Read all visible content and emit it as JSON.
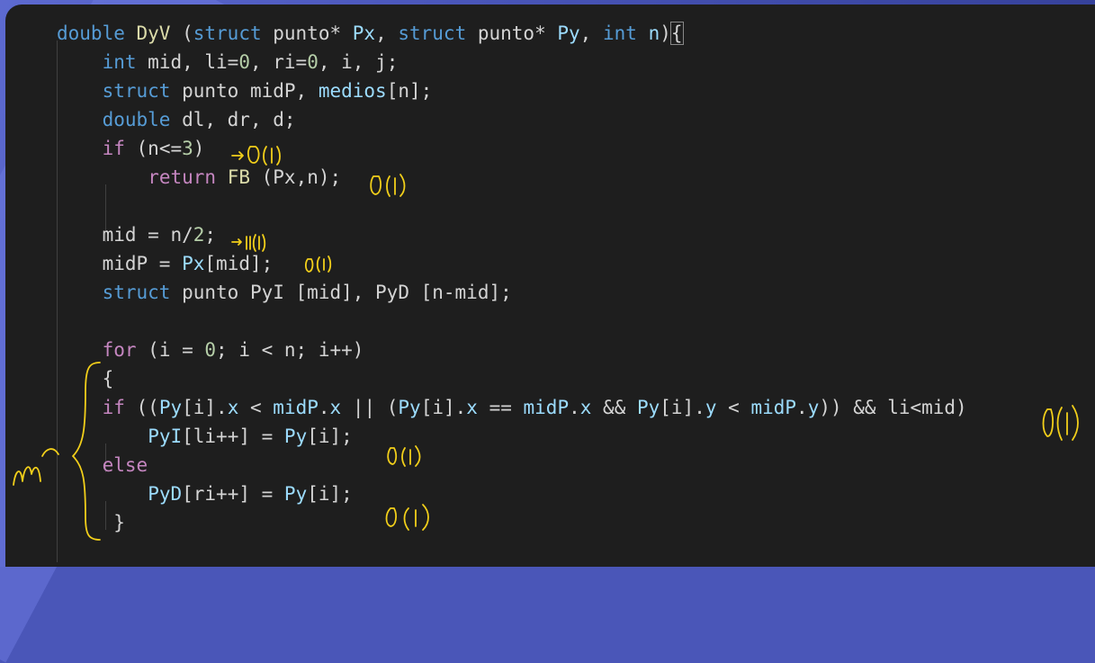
{
  "code": {
    "lines": [
      {
        "indent": "",
        "tokens": [
          [
            "kw",
            "double "
          ],
          [
            "fn",
            "DyV"
          ],
          [
            "t",
            " ("
          ],
          [
            "kw",
            "struct"
          ],
          [
            "t",
            " punto* "
          ],
          [
            "var",
            "Px"
          ],
          [
            "t",
            ", "
          ],
          [
            "kw",
            "struct"
          ],
          [
            "t",
            " punto* "
          ],
          [
            "var",
            "Py"
          ],
          [
            "t",
            ", "
          ],
          [
            "kw",
            "int"
          ],
          [
            "t",
            " "
          ],
          [
            "var",
            "n"
          ],
          [
            "t",
            ")"
          ],
          [
            "hl",
            "{"
          ]
        ]
      },
      {
        "indent": "    ",
        "tokens": [
          [
            "kw",
            "int"
          ],
          [
            "t",
            " mid, li="
          ],
          [
            "num",
            "0"
          ],
          [
            "t",
            ", ri="
          ],
          [
            "num",
            "0"
          ],
          [
            "t",
            ", i, j;"
          ]
        ]
      },
      {
        "indent": "    ",
        "tokens": [
          [
            "kw",
            "struct"
          ],
          [
            "t",
            " punto midP, "
          ],
          [
            "var",
            "medios"
          ],
          [
            "t",
            "[n];"
          ]
        ]
      },
      {
        "indent": "    ",
        "tokens": [
          [
            "kw",
            "double"
          ],
          [
            "t",
            " dl, dr, d;"
          ]
        ]
      },
      {
        "indent": "    ",
        "tokens": [
          [
            "ctl",
            "if"
          ],
          [
            "t",
            " (n<="
          ],
          [
            "num",
            "3"
          ],
          [
            "t",
            ")"
          ]
        ]
      },
      {
        "indent": "        ",
        "tokens": [
          [
            "ctl",
            "return"
          ],
          [
            "t",
            " "
          ],
          [
            "fn",
            "FB"
          ],
          [
            "t",
            " (Px,n);"
          ]
        ]
      },
      {
        "indent": "",
        "tokens": []
      },
      {
        "indent": "    ",
        "tokens": [
          [
            "t",
            "mid = n/"
          ],
          [
            "num",
            "2"
          ],
          [
            "t",
            ";"
          ]
        ]
      },
      {
        "indent": "    ",
        "tokens": [
          [
            "t",
            "midP = "
          ],
          [
            "var",
            "Px"
          ],
          [
            "t",
            "[mid];"
          ]
        ]
      },
      {
        "indent": "    ",
        "tokens": [
          [
            "kw",
            "struct"
          ],
          [
            "t",
            " punto PyI [mid], PyD [n-mid];"
          ]
        ]
      },
      {
        "indent": "",
        "tokens": []
      },
      {
        "indent": "    ",
        "tokens": [
          [
            "ctl",
            "for"
          ],
          [
            "t",
            " (i = "
          ],
          [
            "num",
            "0"
          ],
          [
            "t",
            "; i < n; i++)"
          ]
        ]
      },
      {
        "indent": "    ",
        "tokens": [
          [
            "t",
            "{"
          ]
        ]
      },
      {
        "indent": "    ",
        "tokens": [
          [
            "ctl",
            "if"
          ],
          [
            "t",
            " (("
          ],
          [
            "var",
            "Py"
          ],
          [
            "t",
            "[i]."
          ],
          [
            "var",
            "x"
          ],
          [
            "t",
            " < "
          ],
          [
            "var",
            "midP"
          ],
          [
            "t",
            "."
          ],
          [
            "var",
            "x"
          ],
          [
            "t",
            " || ("
          ],
          [
            "var",
            "Py"
          ],
          [
            "t",
            "[i]."
          ],
          [
            "var",
            "x"
          ],
          [
            "t",
            " == "
          ],
          [
            "var",
            "midP"
          ],
          [
            "t",
            "."
          ],
          [
            "var",
            "x"
          ],
          [
            "t",
            " && "
          ],
          [
            "var",
            "Py"
          ],
          [
            "t",
            "[i]."
          ],
          [
            "var",
            "y"
          ],
          [
            "t",
            " < "
          ],
          [
            "var",
            "midP"
          ],
          [
            "t",
            "."
          ],
          [
            "var",
            "y"
          ],
          [
            "t",
            ")) && li<mid)"
          ]
        ]
      },
      {
        "indent": "        ",
        "tokens": [
          [
            "var",
            "PyI"
          ],
          [
            "t",
            "[li++] = "
          ],
          [
            "var",
            "Py"
          ],
          [
            "t",
            "[i];"
          ]
        ]
      },
      {
        "indent": "    ",
        "tokens": [
          [
            "ctl",
            "else"
          ]
        ]
      },
      {
        "indent": "        ",
        "tokens": [
          [
            "var",
            "PyD"
          ],
          [
            "t",
            "[ri++] = "
          ],
          [
            "var",
            "Py"
          ],
          [
            "t",
            "[i];"
          ]
        ]
      },
      {
        "indent": "     ",
        "tokens": [
          [
            "t",
            "}"
          ]
        ]
      }
    ]
  },
  "annotations": {
    "arrow_O1": "→O(1)",
    "O1": "O(1)",
    "n_mark": "n"
  }
}
